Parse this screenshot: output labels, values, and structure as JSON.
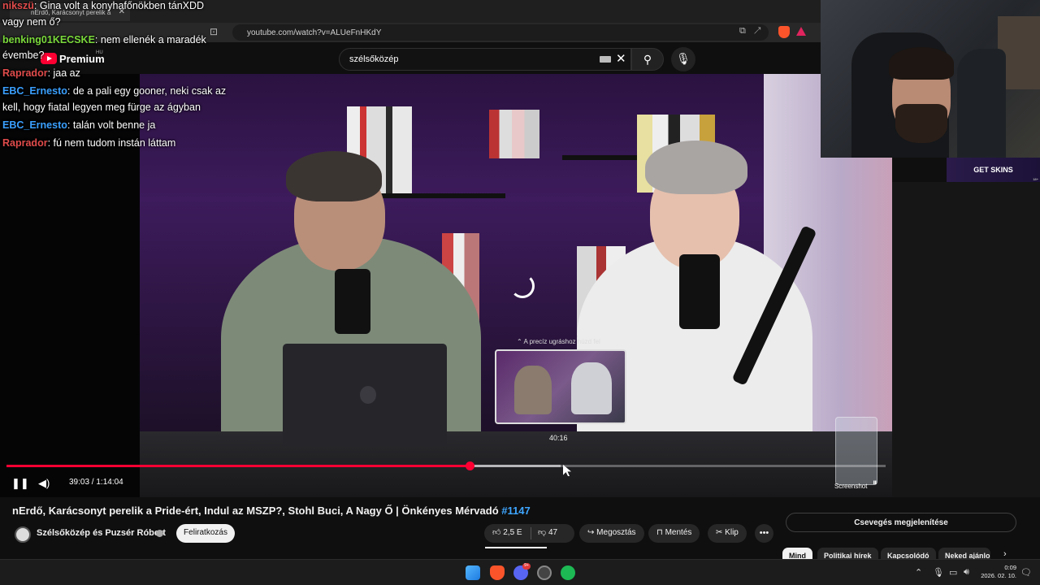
{
  "browser": {
    "tab_title": "nErdő, Karácsonyt perelik a",
    "url": "youtube.com/watch?v=ALUeFnHKdY"
  },
  "youtube": {
    "logo_text": "Premium",
    "region": "HU",
    "search_value": "szélsőközép"
  },
  "chat_overlay": [
    {
      "user": "nikszü",
      "text": "Gina volt a konyhafőnökben tánXDD",
      "color": "red"
    },
    {
      "user": "",
      "text": "vagy nem ő?",
      "color": "none"
    },
    {
      "user": "benking01KECSKE",
      "text": "nem ellenék a maradék",
      "color": "green"
    },
    {
      "user": "",
      "text": "évembe?",
      "color": "none"
    },
    {
      "user": "Raprador",
      "text": "jaa az",
      "color": "red"
    },
    {
      "user": "EBC_Ernesto",
      "text": "de a pali egy gooner, neki csak az",
      "color": "blue"
    },
    {
      "user": "",
      "text": "kell, hogy fiatal legyen meg fürge az ágyban",
      "color": "none"
    },
    {
      "user": "EBC_Ernesto",
      "text": "talán volt benne ja",
      "color": "blue"
    },
    {
      "user": "Raprador",
      "text": "fú nem tudom instán láttam",
      "color": "red"
    }
  ],
  "player": {
    "current_time": "39:03",
    "duration": "1:14:04",
    "time_display": "39:03 / 1:14:04",
    "preview_label": "A precíz ugráshoz húzd fel",
    "preview_time": "40:16",
    "screenshot_label": "Screenshot",
    "progress_fraction": 0.527,
    "colors": {
      "accent": "#ff0033"
    }
  },
  "video": {
    "title": "nErdő, Karácsonyt perelik a Pride-ért, Indul az MSZP?, Stohl Buci, A Nagy Ő | Önkényes Mérvadó",
    "title_tag": "#1147",
    "channel": "Szélsőközép és Puzsér Róbert",
    "subscribe_label": "Feliratkozás",
    "likes": "2,5 E",
    "dislikes": "47",
    "share_label": "Megosztás",
    "save_label": "Mentés",
    "clip_label": "Klip"
  },
  "sidebar": {
    "show_chat_label": "Csevegés megjelenítése",
    "chips": [
      "Mind",
      "Politikai hírek",
      "Kapcsolódó",
      "Neked ajánlo"
    ]
  },
  "overlay": {
    "get_skins": "GET SKINS",
    "age": "18+"
  },
  "taskbar": {
    "discord_badge": "9+",
    "time": "0:09",
    "date": "2026. 02. 10."
  }
}
